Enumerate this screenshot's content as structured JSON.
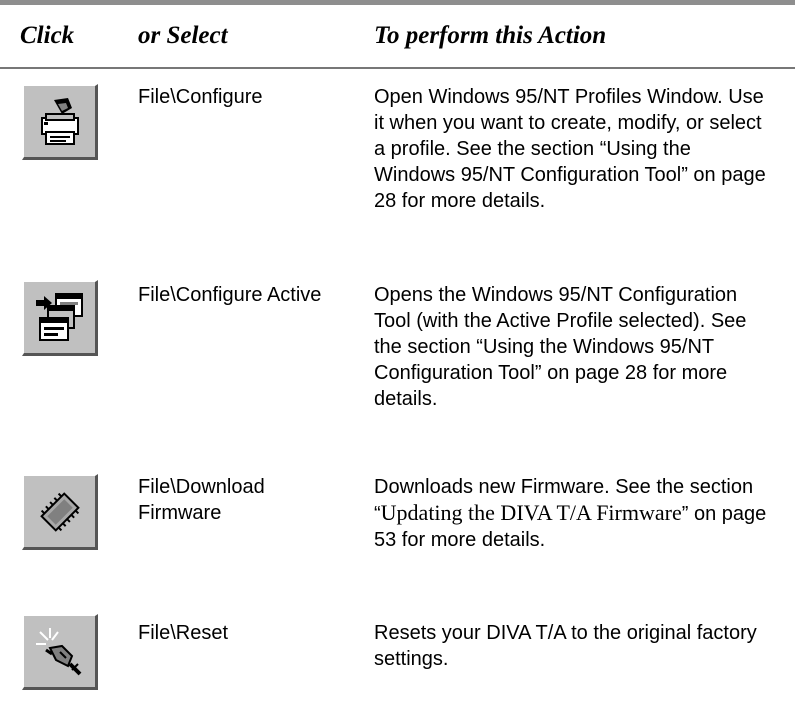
{
  "header": {
    "click": "Click",
    "select": "or Select",
    "action": "To perform this Action"
  },
  "rows": [
    {
      "icon": "printer-config-icon",
      "select": "File\\Configure",
      "action": "Open Windows 95/NT Profiles Window. Use it when you want to create, modify, or select a profile. See the section “Using the Windows 95/NT Configuration Tool” on page 28 for more details."
    },
    {
      "icon": "configure-active-icon",
      "select": "File\\Configure Active",
      "action": "Opens the Windows 95/NT Configuration Tool (with the Active Profile selected). See the section “Using the Windows 95/NT Configuration Tool” on page 28 for more details."
    },
    {
      "icon": "firmware-chip-icon",
      "select": "File\\Download Firmware",
      "action_pre": "Downloads new Firmware. See the section “",
      "action_serif": "Updating the DIVA T/A Firmware",
      "action_post": "” on page 53 for more details."
    },
    {
      "icon": "reset-plug-icon",
      "select": "File\\Reset",
      "action": "Resets your DIVA T/A to the original factory settings."
    }
  ]
}
